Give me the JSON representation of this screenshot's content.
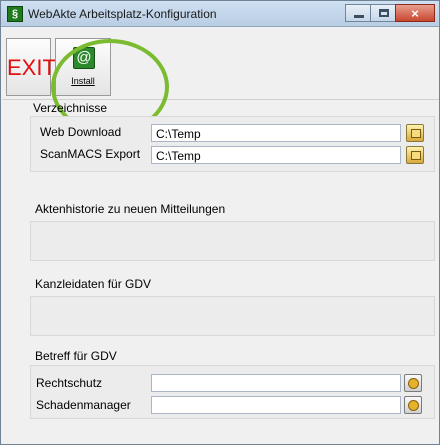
{
  "window": {
    "title": "WebAkte Arbeitsplatz-Konfiguration",
    "app_icon": "§",
    "close_glyph": "×"
  },
  "toolbar": {
    "exit_label": "EXIT",
    "install_label": "Install",
    "install_icon": "globe-at-icon"
  },
  "sections": {
    "verzeichnisse": {
      "heading": "Verzeichnisse",
      "rows": [
        {
          "label": "Web Download",
          "value": "C:\\Temp",
          "button_icon": "folder-icon"
        },
        {
          "label": "ScanMACS Export",
          "value": "C:\\Temp",
          "button_icon": "folder-icon"
        }
      ]
    },
    "aktenhistorie": {
      "heading": "Aktenhistorie zu neuen Mitteilungen"
    },
    "kanzleidaten": {
      "heading": "Kanzleidaten für GDV"
    },
    "betreff": {
      "heading": "Betreff für GDV",
      "rows": [
        {
          "label": "Rechtschutz",
          "value": "",
          "button_icon": "key-icon"
        },
        {
          "label": "Schadenmanager",
          "value": "",
          "button_icon": "key-icon"
        }
      ]
    }
  },
  "colors": {
    "exit_text": "#e01010",
    "annotation_circle": "#7bbb30",
    "title_bar": "#cfe0f2"
  }
}
